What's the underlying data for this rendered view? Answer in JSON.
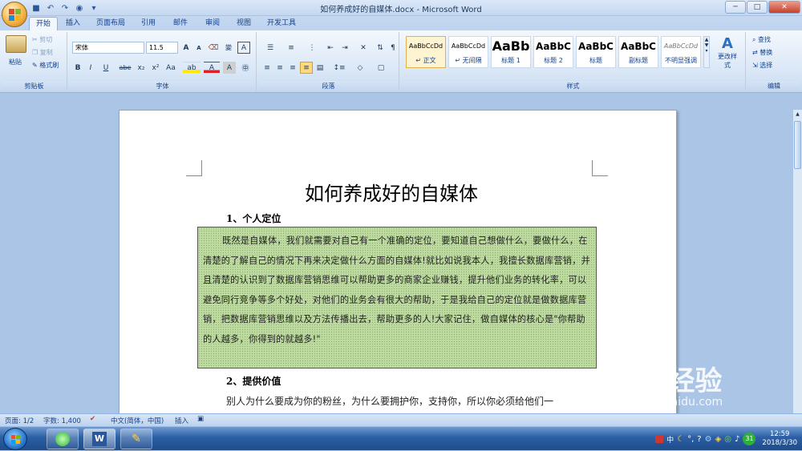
{
  "window": {
    "title": "如何养成好的自媒体.docx - Microsoft Word",
    "minimize": "─",
    "maximize": "□",
    "close": "✕"
  },
  "tabs": [
    "开始",
    "插入",
    "页面布局",
    "引用",
    "邮件",
    "审阅",
    "视图",
    "开发工具"
  ],
  "clipboard": {
    "paste": "粘贴",
    "cut": "剪切",
    "copy": "复制",
    "format_painter": "格式刷",
    "label": "剪贴板"
  },
  "font": {
    "name": "宋体",
    "size": "11.5",
    "label": "字体",
    "wen": "變",
    "ab": "abe",
    "x2": "x₂",
    "x2sup": "x²",
    "aa": "Aa",
    "grow": "A",
    "shrink": "A"
  },
  "paragraph": {
    "label": "段落"
  },
  "styles": {
    "label": "样式",
    "items": [
      {
        "sample": "AaBbCcDd",
        "name": "↵ 正文"
      },
      {
        "sample": "AaBbCcDd",
        "name": "↵ 无间隔"
      },
      {
        "sample": "AaBb",
        "name": "标题 1"
      },
      {
        "sample": "AaBbC",
        "name": "标题 2"
      },
      {
        "sample": "AaBbC",
        "name": "标题"
      },
      {
        "sample": "AaBbC",
        "name": "副标题"
      },
      {
        "sample": "AaBbCcDd",
        "name": "不明显强调"
      }
    ],
    "change": "更改样式"
  },
  "editing": {
    "find": "查找",
    "replace": "替换",
    "select": "选择",
    "label": "编辑"
  },
  "document": {
    "heading": "如何养成好的自媒体",
    "section1": "1、个人定位",
    "para1": "既然是自媒体，我们就需要对自己有一个准确的定位，要知道自己想做什么，要做什么，在清楚的了解自己的情况下再来决定做什么方面的自媒体!就比如说我本人，我擅长数据库营销，并且清楚的认识到了数据库营销思维可以帮助更多的商家企业赚钱，提升他们业务的转化率，可以避免同行竞争等多个好处，对他们的业务会有很大的帮助，于是我给自己的定位就是做数据库营销，把数据库营销思维以及方法传播出去，帮助更多的人!大家记住，做自媒体的核心是\"你帮助的人越多，你得到的就越多!\"",
    "section2": "2、提供价值",
    "para2": "别人为什么要成为你的粉丝，为什么要拥护你，支持你，所以你必须给他们一"
  },
  "status": {
    "page": "页面: 1/2",
    "words": "字数: 1,400",
    "lang": "中文(简体，中国)",
    "insert": "插入"
  },
  "taskbar": {
    "time": "12:59",
    "date": "2018/3/30",
    "ime": "中",
    "badge": "31"
  },
  "watermark": {
    "brand": "Bai 经验",
    "url": "jingyan.baidu.com"
  },
  "colors": {
    "accent": "#2b579a",
    "shade": "#bddaa0",
    "ribbon": "#dbe8f8"
  }
}
